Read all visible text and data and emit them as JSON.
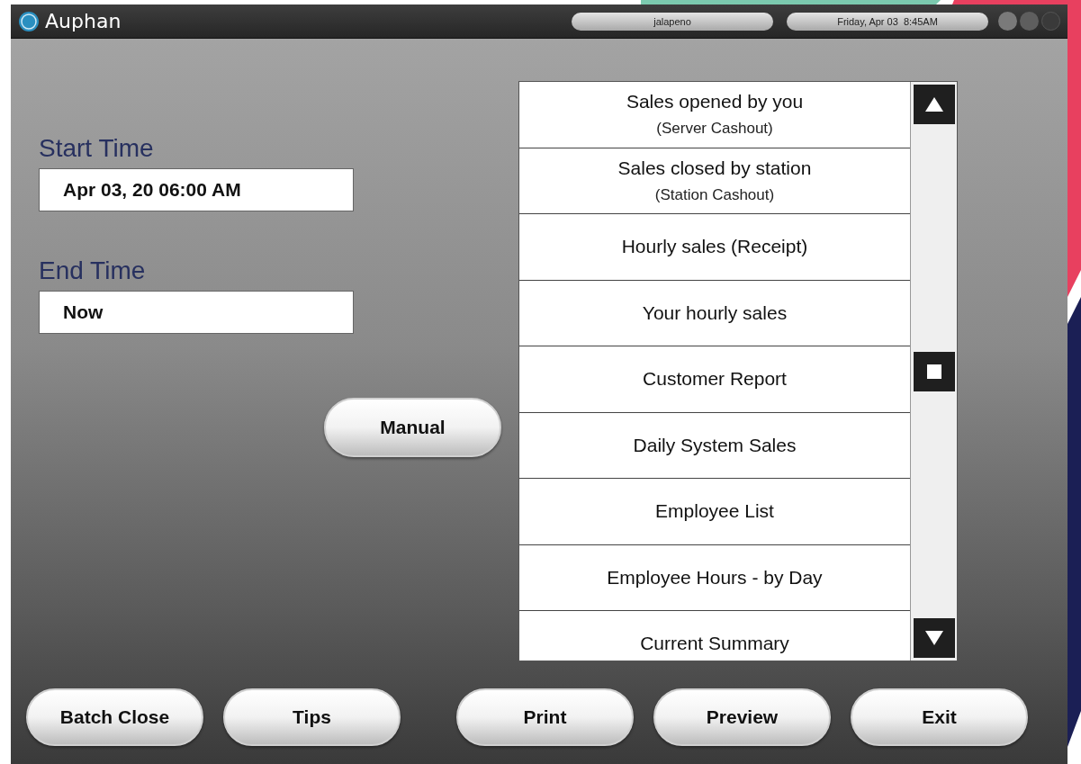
{
  "header": {
    "logo_text": "Auphan",
    "user": "jalapeno",
    "datetime": "Friday, Apr 03  8:45AM"
  },
  "start_time": {
    "label": "Start Time",
    "value": "Apr 03, 20 06:00 AM"
  },
  "end_time": {
    "label": "End Time",
    "value": "Now"
  },
  "manual_button": "Manual",
  "reports": [
    {
      "title": "Sales opened by you",
      "subtitle": "(Server Cashout)"
    },
    {
      "title": "Sales closed by station",
      "subtitle": "(Station Cashout)"
    },
    {
      "title": "Hourly sales (Receipt)"
    },
    {
      "title": "Your hourly sales"
    },
    {
      "title": "Customer Report"
    },
    {
      "title": "Daily System Sales"
    },
    {
      "title": "Employee List"
    },
    {
      "title": "Employee Hours - by Day"
    },
    {
      "title": "Current Summary"
    }
  ],
  "bottom_buttons": [
    "Batch Close",
    "Tips",
    "Print",
    "Preview",
    "Exit"
  ]
}
